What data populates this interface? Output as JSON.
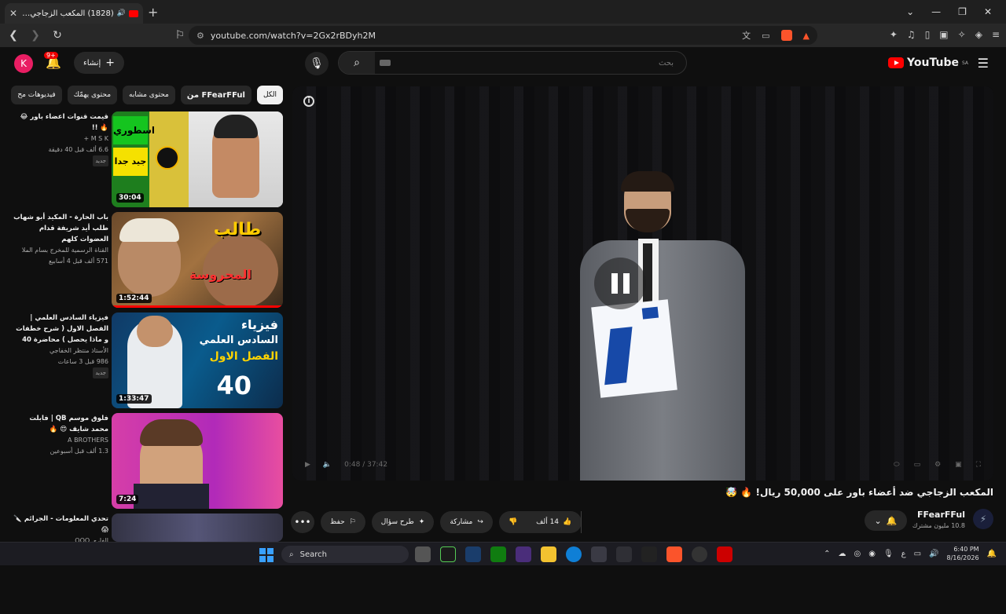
{
  "browser": {
    "tab_title": "(1828) المكعب الزجاجي ضد أ...",
    "tab_close": "✕",
    "new_tab": "+",
    "url": "youtube.com/watch?v=2Gx2rBDyh2M",
    "window_controls": [
      "⌄",
      "—",
      "❐",
      "✕"
    ]
  },
  "header": {
    "avatar_letter": "K",
    "notif_badge": "9+",
    "create_label": "إنشاء",
    "search_placeholder": "بحث",
    "logo_text": "YouTube",
    "logo_region": "SA"
  },
  "chips": [
    "الكل",
    "من FFearFFul",
    "محتوى مشابه",
    "محتوى يهمّك",
    "فيديوهات مح"
  ],
  "recommendations": [
    {
      "title": "قيمت قنوات اعضاء باور 😂🔥 !!",
      "channel": "M S K +",
      "meta": "6.6 ألف  قبل 40 دقيقة",
      "badge": "جديد",
      "duration": "30:04"
    },
    {
      "title": "باب الحارة - المكيد أبو شهاب طلب أيد شريفة قدام العضوات كلهم",
      "channel": "القناة الرسمية للمخرج بسام الملا",
      "meta": "571 ألف  قبل 4 أسابيع",
      "badge": "",
      "duration": "1:52:44"
    },
    {
      "title": "فيزياء السادس العلمي | الفصل الاول ( شرح خطفات و ماذا يحصل ) محاضرة 40",
      "channel": "الأستاذ منتظر الخفاجي",
      "meta": "986  قبل 3 ساعات",
      "badge": "جديد",
      "duration": "1:33:47"
    },
    {
      "title": "فلوق موسم QB | فابلت محمد شايف 😍 🔥",
      "channel": "A BROTHERS",
      "meta": "1.3 ألف  قبل أسبوعين",
      "badge": "",
      "duration": "7:24"
    },
    {
      "title": "تحدي المعلومات - الجرائم 🔪 😱",
      "channel": "الفاري QQQ",
      "meta": "",
      "badge": "",
      "duration": ""
    }
  ],
  "player": {
    "time": "0:48 / 37:42",
    "pause_glyph": "❚❚"
  },
  "video": {
    "title": "المكعب الزجاجي ضد أعضاء باور على 50,000 ريال! 🔥 🤯",
    "channel_name": "FFearFFul",
    "subscribers": "10.8 مليون مشترك",
    "likes": "14 ألف",
    "share": "مشاركة",
    "ask": "طرح سؤال",
    "save": "حفظ",
    "more": "•••"
  },
  "taskbar": {
    "search_label": "Search",
    "time": "6:40 PM",
    "date": "8/16/2026",
    "lang": "ع"
  },
  "colors": {
    "brand": "#ff0000",
    "bg": "#0f0f0f",
    "chip_bg": "#272727"
  }
}
